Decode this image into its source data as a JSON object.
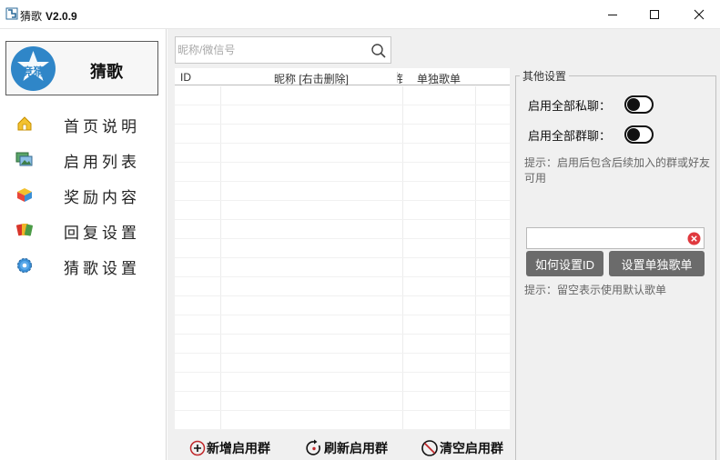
{
  "window": {
    "title": "猜歌",
    "version": "V2.0.9",
    "minimize_icon": "minimize-icon",
    "maximize_icon": "maximize-icon",
    "close_icon": "close-icon"
  },
  "sidebar": {
    "brand": {
      "logo_text": "竞猜",
      "name": "猜歌"
    },
    "items": [
      {
        "label": "首页说明",
        "icon": "home-icon"
      },
      {
        "label": "启用列表",
        "icon": "photos-icon"
      },
      {
        "label": "奖励内容",
        "icon": "gift-box-icon"
      },
      {
        "label": "回复设置",
        "icon": "cards-icon"
      },
      {
        "label": "猜歌设置",
        "icon": "gear-icon"
      }
    ]
  },
  "main": {
    "search": {
      "placeholder": "昵称/微信号",
      "value": ""
    },
    "table": {
      "columns": [
        "ID",
        "昵称 [右击删除]",
        "钅",
        "单独歌单"
      ],
      "rows": []
    },
    "actions": [
      {
        "label": "新增启用群",
        "icon": "add-circle-icon"
      },
      {
        "label": "刷新启用群",
        "icon": "refresh-icon"
      },
      {
        "label": "清空启用群",
        "icon": "prohibit-icon"
      }
    ]
  },
  "other_settings": {
    "title": "其他设置",
    "toggle_private": {
      "label": "启用全部私聊：",
      "on": false
    },
    "toggle_group": {
      "label": "启用全部群聊：",
      "on": false
    },
    "hint1": "提示：启用后包含后续加入的群或好友可用",
    "id_input": {
      "value": "",
      "placeholder": ""
    },
    "how_button": "如何设置ID",
    "set_playlist_button": "设置单独歌单",
    "hint2": "提示：留空表示使用默认歌单"
  },
  "colors": {
    "accent_blue": "#2f86c8",
    "button_gray": "#6b6b6b",
    "clear_red": "#e0393e"
  }
}
